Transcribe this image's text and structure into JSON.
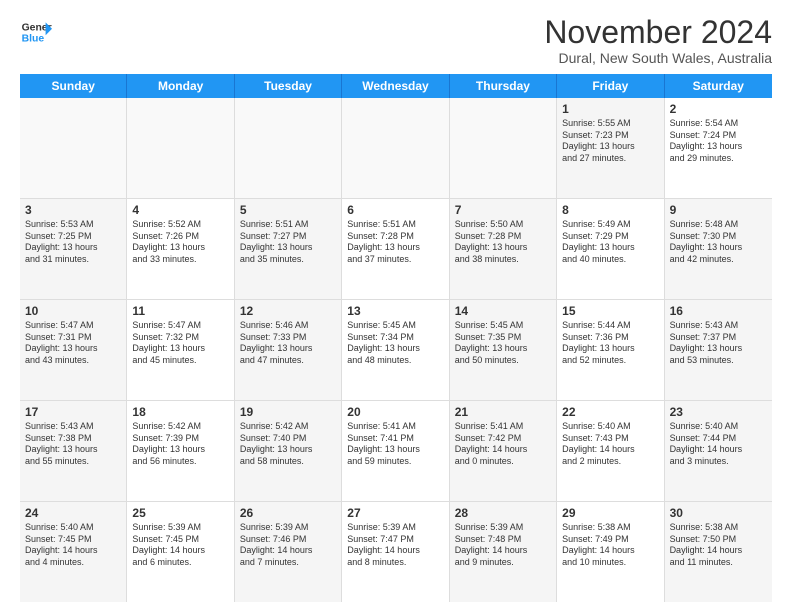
{
  "header": {
    "logo_general": "General",
    "logo_blue": "Blue",
    "month_title": "November 2024",
    "location": "Dural, New South Wales, Australia"
  },
  "weekdays": [
    "Sunday",
    "Monday",
    "Tuesday",
    "Wednesday",
    "Thursday",
    "Friday",
    "Saturday"
  ],
  "rows": [
    {
      "cells": [
        {
          "day": "",
          "text": "",
          "empty": true
        },
        {
          "day": "",
          "text": "",
          "empty": true
        },
        {
          "day": "",
          "text": "",
          "empty": true
        },
        {
          "day": "",
          "text": "",
          "empty": true
        },
        {
          "day": "",
          "text": "",
          "empty": true
        },
        {
          "day": "1",
          "text": "Sunrise: 5:55 AM\nSunset: 7:23 PM\nDaylight: 13 hours\nand 27 minutes.",
          "shaded": true
        },
        {
          "day": "2",
          "text": "Sunrise: 5:54 AM\nSunset: 7:24 PM\nDaylight: 13 hours\nand 29 minutes.",
          "shaded": false
        }
      ]
    },
    {
      "cells": [
        {
          "day": "3",
          "text": "Sunrise: 5:53 AM\nSunset: 7:25 PM\nDaylight: 13 hours\nand 31 minutes.",
          "shaded": true
        },
        {
          "day": "4",
          "text": "Sunrise: 5:52 AM\nSunset: 7:26 PM\nDaylight: 13 hours\nand 33 minutes.",
          "shaded": false
        },
        {
          "day": "5",
          "text": "Sunrise: 5:51 AM\nSunset: 7:27 PM\nDaylight: 13 hours\nand 35 minutes.",
          "shaded": true
        },
        {
          "day": "6",
          "text": "Sunrise: 5:51 AM\nSunset: 7:28 PM\nDaylight: 13 hours\nand 37 minutes.",
          "shaded": false
        },
        {
          "day": "7",
          "text": "Sunrise: 5:50 AM\nSunset: 7:28 PM\nDaylight: 13 hours\nand 38 minutes.",
          "shaded": true
        },
        {
          "day": "8",
          "text": "Sunrise: 5:49 AM\nSunset: 7:29 PM\nDaylight: 13 hours\nand 40 minutes.",
          "shaded": false
        },
        {
          "day": "9",
          "text": "Sunrise: 5:48 AM\nSunset: 7:30 PM\nDaylight: 13 hours\nand 42 minutes.",
          "shaded": true
        }
      ]
    },
    {
      "cells": [
        {
          "day": "10",
          "text": "Sunrise: 5:47 AM\nSunset: 7:31 PM\nDaylight: 13 hours\nand 43 minutes.",
          "shaded": true
        },
        {
          "day": "11",
          "text": "Sunrise: 5:47 AM\nSunset: 7:32 PM\nDaylight: 13 hours\nand 45 minutes.",
          "shaded": false
        },
        {
          "day": "12",
          "text": "Sunrise: 5:46 AM\nSunset: 7:33 PM\nDaylight: 13 hours\nand 47 minutes.",
          "shaded": true
        },
        {
          "day": "13",
          "text": "Sunrise: 5:45 AM\nSunset: 7:34 PM\nDaylight: 13 hours\nand 48 minutes.",
          "shaded": false
        },
        {
          "day": "14",
          "text": "Sunrise: 5:45 AM\nSunset: 7:35 PM\nDaylight: 13 hours\nand 50 minutes.",
          "shaded": true
        },
        {
          "day": "15",
          "text": "Sunrise: 5:44 AM\nSunset: 7:36 PM\nDaylight: 13 hours\nand 52 minutes.",
          "shaded": false
        },
        {
          "day": "16",
          "text": "Sunrise: 5:43 AM\nSunset: 7:37 PM\nDaylight: 13 hours\nand 53 minutes.",
          "shaded": true
        }
      ]
    },
    {
      "cells": [
        {
          "day": "17",
          "text": "Sunrise: 5:43 AM\nSunset: 7:38 PM\nDaylight: 13 hours\nand 55 minutes.",
          "shaded": true
        },
        {
          "day": "18",
          "text": "Sunrise: 5:42 AM\nSunset: 7:39 PM\nDaylight: 13 hours\nand 56 minutes.",
          "shaded": false
        },
        {
          "day": "19",
          "text": "Sunrise: 5:42 AM\nSunset: 7:40 PM\nDaylight: 13 hours\nand 58 minutes.",
          "shaded": true
        },
        {
          "day": "20",
          "text": "Sunrise: 5:41 AM\nSunset: 7:41 PM\nDaylight: 13 hours\nand 59 minutes.",
          "shaded": false
        },
        {
          "day": "21",
          "text": "Sunrise: 5:41 AM\nSunset: 7:42 PM\nDaylight: 14 hours\nand 0 minutes.",
          "shaded": true
        },
        {
          "day": "22",
          "text": "Sunrise: 5:40 AM\nSunset: 7:43 PM\nDaylight: 14 hours\nand 2 minutes.",
          "shaded": false
        },
        {
          "day": "23",
          "text": "Sunrise: 5:40 AM\nSunset: 7:44 PM\nDaylight: 14 hours\nand 3 minutes.",
          "shaded": true
        }
      ]
    },
    {
      "cells": [
        {
          "day": "24",
          "text": "Sunrise: 5:40 AM\nSunset: 7:45 PM\nDaylight: 14 hours\nand 4 minutes.",
          "shaded": true
        },
        {
          "day": "25",
          "text": "Sunrise: 5:39 AM\nSunset: 7:45 PM\nDaylight: 14 hours\nand 6 minutes.",
          "shaded": false
        },
        {
          "day": "26",
          "text": "Sunrise: 5:39 AM\nSunset: 7:46 PM\nDaylight: 14 hours\nand 7 minutes.",
          "shaded": true
        },
        {
          "day": "27",
          "text": "Sunrise: 5:39 AM\nSunset: 7:47 PM\nDaylight: 14 hours\nand 8 minutes.",
          "shaded": false
        },
        {
          "day": "28",
          "text": "Sunrise: 5:39 AM\nSunset: 7:48 PM\nDaylight: 14 hours\nand 9 minutes.",
          "shaded": true
        },
        {
          "day": "29",
          "text": "Sunrise: 5:38 AM\nSunset: 7:49 PM\nDaylight: 14 hours\nand 10 minutes.",
          "shaded": false
        },
        {
          "day": "30",
          "text": "Sunrise: 5:38 AM\nSunset: 7:50 PM\nDaylight: 14 hours\nand 11 minutes.",
          "shaded": true
        }
      ]
    }
  ]
}
